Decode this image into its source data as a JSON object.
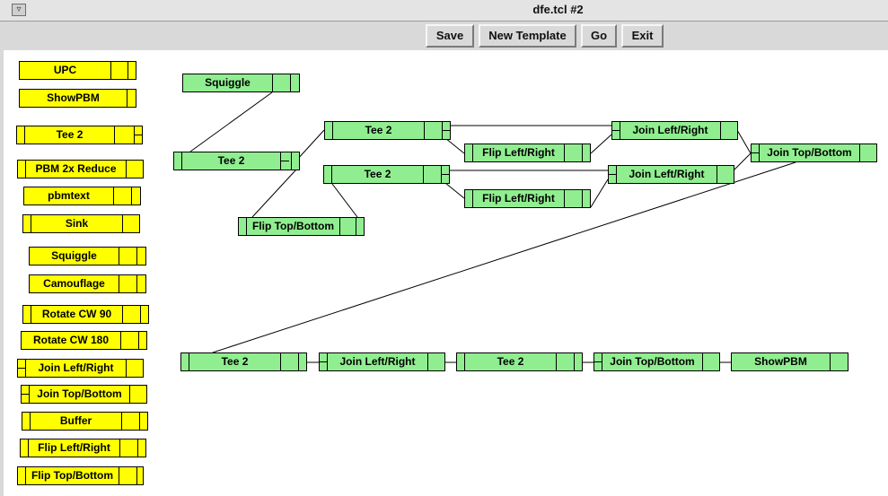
{
  "window": {
    "title": "dfe.tcl #2",
    "menu_glyph": "▿"
  },
  "toolbar": {
    "save": "Save",
    "new_template": "New Template",
    "go": "Go",
    "exit": "Exit"
  },
  "palette": [
    "UPC",
    "ShowPBM",
    "Tee 2",
    "PBM 2x Reduce",
    "pbmtext",
    "Sink",
    "Squiggle",
    "Camouflage",
    "Rotate CW 90",
    "Rotate CW 180",
    "Join Left/Right",
    "Join Top/Bottom",
    "Buffer",
    "Flip Left/Right",
    "Flip Top/Bottom"
  ],
  "network": {
    "nodes": [
      "Squiggle",
      "Tee 2",
      "Flip Top/Bottom",
      "Tee 2",
      "Tee 2",
      "Flip Left/Right",
      "Flip Left/Right",
      "Join Left/Right",
      "Join Left/Right",
      "Join Top/Bottom",
      "Tee 2",
      "Join Left/Right",
      "Tee 2",
      "Join Top/Bottom",
      "ShowPBM"
    ]
  },
  "colors": {
    "palette_node": "#ffff00",
    "network_node": "#90ee90",
    "canvas": "#ffffff",
    "chrome": "#d9d9d9"
  }
}
